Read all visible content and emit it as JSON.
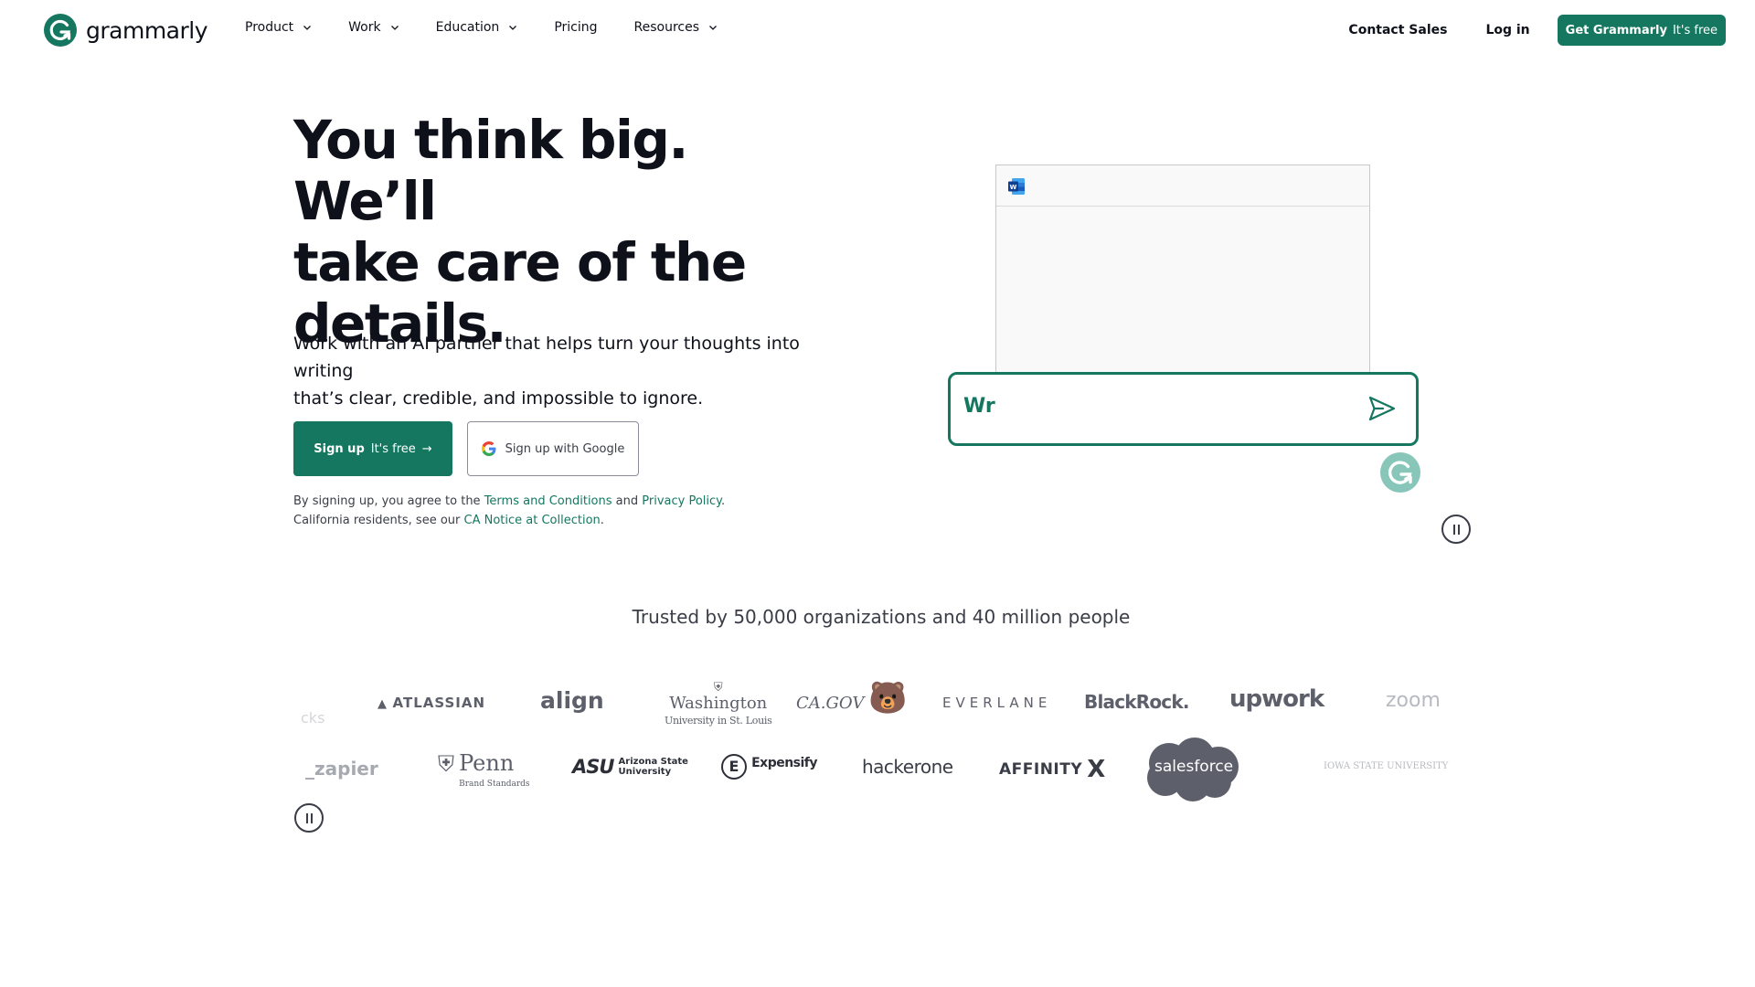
{
  "nav": {
    "brand": "grammarly",
    "items": [
      {
        "label": "Product",
        "dropdown": true
      },
      {
        "label": "Work",
        "dropdown": true
      },
      {
        "label": "Education",
        "dropdown": true
      },
      {
        "label": "Pricing",
        "dropdown": false
      },
      {
        "label": "Resources",
        "dropdown": true
      }
    ],
    "contact_sales": "Contact Sales",
    "login": "Log in",
    "cta_bold": "Get Grammarly",
    "cta_free": "It's free"
  },
  "hero": {
    "title_line1": "You think big. We’ll",
    "title_line2": "take care of the",
    "title_line3": "details.",
    "subtitle_line1": "Work with an AI partner that helps turn your thoughts into writing",
    "subtitle_line2": "that’s clear, credible, and impossible to ignore.",
    "signup_bold": "Sign up",
    "signup_free": "It's free",
    "signup_arrow": "→",
    "google_label": "Sign up with Google",
    "legal_prefix": "By signing up, you agree to the",
    "terms": "Terms and Conditions",
    "legal_and": "and",
    "privacy": "Privacy Policy",
    "legal_period": ".",
    "ca_prefix": "California residents, see our",
    "ca_link": "CA Notice at Collection",
    "ca_period": "."
  },
  "demo": {
    "prompt_text": "Wr"
  },
  "trust": {
    "headline": "Trusted by 50,000 organizations and 40 million people",
    "row1": {
      "partial": "cks",
      "atlassian": "ATLASSIAN",
      "align": "align",
      "washington_1": "Washington",
      "washington_2": "University in St. Louis",
      "cagov": "CA.GOV",
      "everlane": "EVERLANE",
      "blackrock": "BlackRock.",
      "upwork": "upwork",
      "zoom": "zoom"
    },
    "row2": {
      "zapier": "_zapier",
      "penn": "Penn",
      "penn_sub": "Brand Standards",
      "asu": "ASU",
      "asu_sub1": "Arizona State",
      "asu_sub2": "University",
      "expensify": "Expensify",
      "hackerone": "hackerone",
      "affinity": "AFFINITY",
      "affinity_x": "X",
      "salesforce": "salesforce",
      "iowa": "IOWA STATE UNIVERSITY"
    }
  },
  "colors": {
    "brand_green": "#15775f",
    "text_dark": "#0e101a",
    "logo_gray": "#5d606b"
  }
}
